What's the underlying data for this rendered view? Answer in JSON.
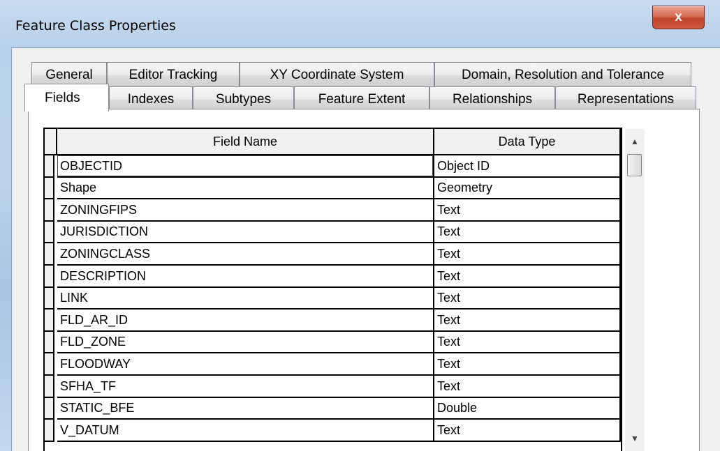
{
  "window": {
    "title": "Feature Class Properties",
    "close_glyph": "x"
  },
  "tabs_row1": [
    "General",
    "Editor Tracking",
    "XY Coordinate System",
    "Domain, Resolution and Tolerance"
  ],
  "tabs_row2": [
    "Fields",
    "Indexes",
    "Subtypes",
    "Feature Extent",
    "Relationships",
    "Representations"
  ],
  "selected_tab": "Fields",
  "table": {
    "columns": [
      "Field Name",
      "Data Type"
    ],
    "rows": [
      {
        "name": "OBJECTID",
        "type": "Object ID"
      },
      {
        "name": "Shape",
        "type": "Geometry"
      },
      {
        "name": "ZONINGFIPS",
        "type": "Text"
      },
      {
        "name": "JURISDICTION",
        "type": "Text"
      },
      {
        "name": "ZONINGCLASS",
        "type": "Text"
      },
      {
        "name": "DESCRIPTION",
        "type": "Text"
      },
      {
        "name": "LINK",
        "type": "Text"
      },
      {
        "name": "FLD_AR_ID",
        "type": "Text"
      },
      {
        "name": "FLD_ZONE",
        "type": "Text"
      },
      {
        "name": "FLOODWAY",
        "type": "Text"
      },
      {
        "name": "SFHA_TF",
        "type": "Text"
      },
      {
        "name": "STATIC_BFE",
        "type": "Double"
      },
      {
        "name": "V_DATUM",
        "type": "Text"
      }
    ]
  },
  "scrollbar": {
    "up_glyph": "▲",
    "down_glyph": "▼"
  },
  "colors": {
    "title_bar": "#b9d1ea",
    "close_button": "#c7432b",
    "tab_panel": "#ffffff",
    "dialog_face": "#f0f0f0"
  }
}
